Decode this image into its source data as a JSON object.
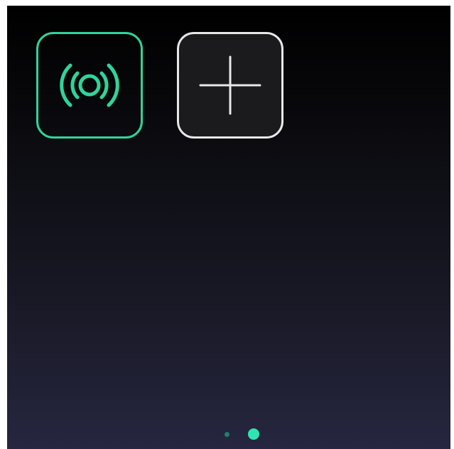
{
  "tiles": [
    {
      "icon": "broadcast-icon",
      "border_color": "#2fd49a"
    },
    {
      "icon": "plus-icon",
      "border_color": "#e8e8e8"
    }
  ],
  "pager": {
    "page_count": 2,
    "current_page": 2,
    "inactive_color": "#1f7f6a",
    "active_color": "#2ee5b0"
  }
}
